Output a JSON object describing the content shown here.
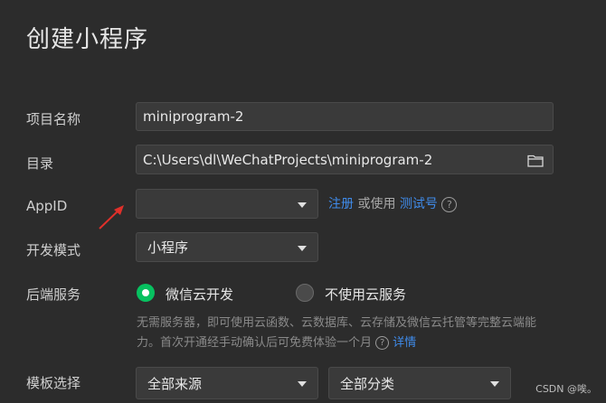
{
  "page": {
    "title": "创建小程序"
  },
  "form": {
    "project_name": {
      "label": "项目名称",
      "value": "miniprogram-2"
    },
    "directory": {
      "label": "目录",
      "value": "C:\\Users\\dl\\WeChatProjects\\miniprogram-2",
      "icon": "folder-icon"
    },
    "appid": {
      "label": "AppID",
      "value": "",
      "register_link": "注册",
      "or_use_text": "或使用",
      "test_id_link": "测试号",
      "help_icon": "?"
    },
    "dev_mode": {
      "label": "开发模式",
      "value": "小程序"
    },
    "backend": {
      "label": "后端服务",
      "options": [
        {
          "label": "微信云开发",
          "selected": true
        },
        {
          "label": "不使用云服务",
          "selected": false
        }
      ],
      "description_line1": "无需服务器，即可使用云函数、云数据库、云存储及微信云托管等完整云端能",
      "description_line2": "力。首次开通经手动确认后可免费体验一个月",
      "details_link": "详情",
      "help_icon": "?"
    },
    "template": {
      "label": "模板选择",
      "source_value": "全部来源",
      "category_value": "全部分类"
    }
  },
  "watermark": "CSDN @唉。",
  "colors": {
    "accent_green": "#07c160",
    "link_blue": "#3f8bea",
    "arrow_red": "#e0302a",
    "background": "#2c2c2c"
  }
}
